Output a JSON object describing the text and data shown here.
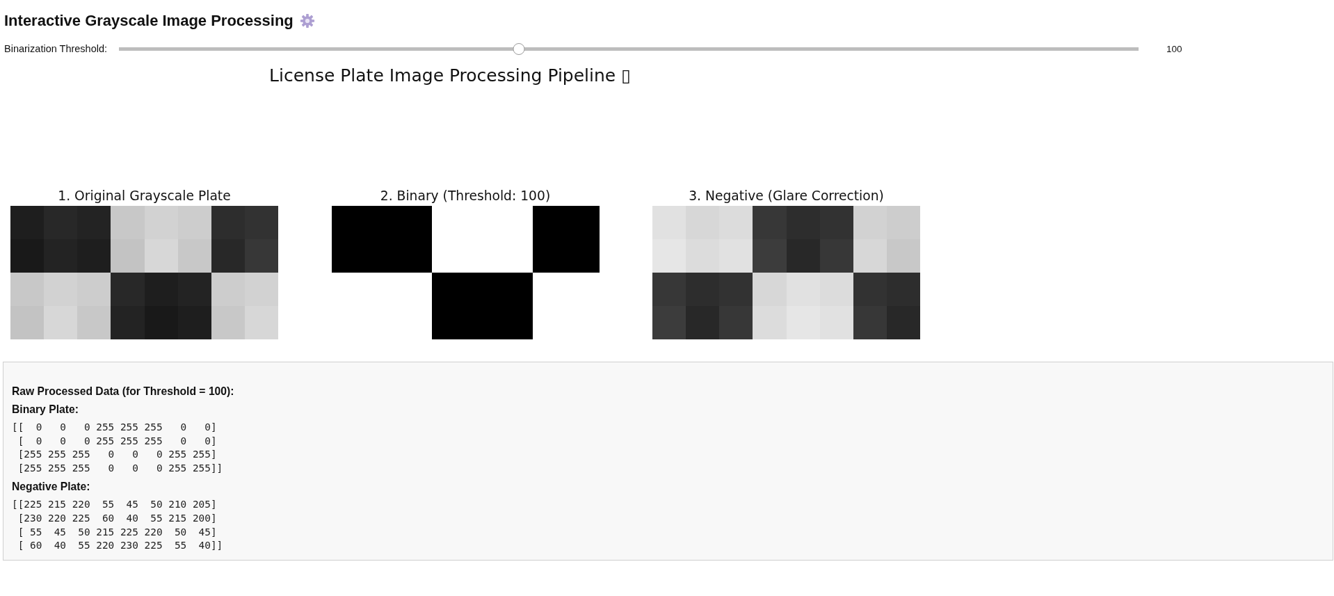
{
  "title": "Interactive Grayscale Image Processing",
  "slider": {
    "label": "Binarization Threshold:",
    "level": 0.392,
    "reading": "100"
  },
  "figure": {
    "title": "License Plate Image Processing Pipeline ▯",
    "panels": [
      {
        "title": "1. Original Grayscale Plate",
        "kind": "grayscale"
      },
      {
        "title": "2. Binary (Threshold: 100)",
        "kind": "binary"
      },
      {
        "title": "3. Negative (Glare Correction)",
        "kind": "negative"
      }
    ]
  },
  "output": {
    "heading": "Raw Processed Data (for Threshold = 100):",
    "sections": [
      {
        "label": "Binary Plate:",
        "matrix": "[[  0   0   0 255 255 255   0   0]\n [  0   0   0 255 255 255   0   0]\n [255 255 255   0   0   0 255 255]\n [255 255 255   0   0   0 255 255]]"
      },
      {
        "label": "Negative Plate:",
        "matrix": "[[225 215 220  55  45  50 210 205]\n [230 220 225  60  40  55 215 200]\n [ 55  45  50 215 225 220  50  45]\n [ 60  40  55 220 230 225  55  40]]"
      }
    ]
  }
}
